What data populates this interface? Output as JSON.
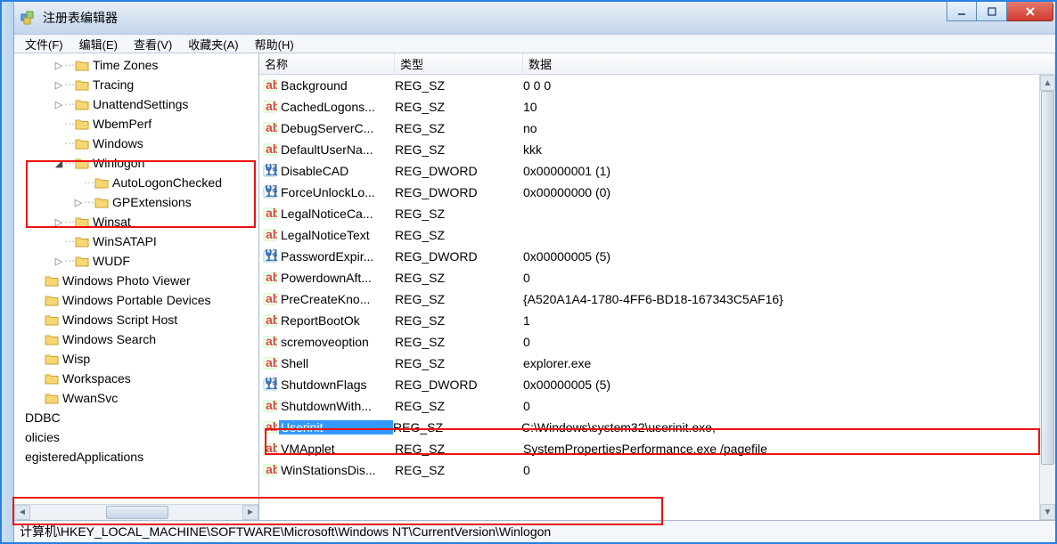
{
  "window": {
    "title": "注册表编辑器"
  },
  "menus": [
    "文件(F)",
    "编辑(E)",
    "查看(V)",
    "收藏夹(A)",
    "帮助(H)"
  ],
  "tree": [
    {
      "indent": 44,
      "toggle": "▷",
      "label": "Time Zones",
      "dots": true
    },
    {
      "indent": 44,
      "toggle": "▷",
      "label": "Tracing",
      "dots": true
    },
    {
      "indent": 44,
      "toggle": "▷",
      "label": "UnattendSettings",
      "dots": true
    },
    {
      "indent": 44,
      "toggle": "",
      "label": "WbemPerf",
      "dots": true
    },
    {
      "indent": 44,
      "toggle": "",
      "label": "Windows",
      "dots": true
    },
    {
      "indent": 44,
      "toggle": "▲",
      "label": "Winlogon",
      "dots": true,
      "expanded": true
    },
    {
      "indent": 66,
      "toggle": "",
      "label": "AutoLogonChecked",
      "dots": true
    },
    {
      "indent": 66,
      "toggle": "▷",
      "label": "GPExtensions",
      "dots": true
    },
    {
      "indent": 44,
      "toggle": "▷",
      "label": "Winsat",
      "dots": true
    },
    {
      "indent": 44,
      "toggle": "",
      "label": "WinSATAPI",
      "dots": true
    },
    {
      "indent": 44,
      "toggle": "▷",
      "label": "WUDF",
      "dots": true
    },
    {
      "indent": 22,
      "toggle": "",
      "label": "Windows Photo Viewer",
      "dots": false
    },
    {
      "indent": 22,
      "toggle": "",
      "label": "Windows Portable Devices",
      "dots": false
    },
    {
      "indent": 22,
      "toggle": "",
      "label": "Windows Script Host",
      "dots": false
    },
    {
      "indent": 22,
      "toggle": "",
      "label": "Windows Search",
      "dots": false
    },
    {
      "indent": 22,
      "toggle": "",
      "label": "Wisp",
      "dots": false
    },
    {
      "indent": 22,
      "toggle": "",
      "label": "Workspaces",
      "dots": false
    },
    {
      "indent": 22,
      "toggle": "",
      "label": "WwanSvc",
      "dots": false
    },
    {
      "indent": 0,
      "toggle": "",
      "label": "DDBC",
      "dots": false,
      "nofolder": true,
      "cut": true
    },
    {
      "indent": 0,
      "toggle": "",
      "label": "olicies",
      "dots": false,
      "nofolder": true,
      "cut": true
    },
    {
      "indent": 0,
      "toggle": "",
      "label": "egisteredApplications",
      "dots": false,
      "nofolder": true,
      "cut": true
    }
  ],
  "columns": {
    "name": "名称",
    "type": "类型",
    "data": "数据"
  },
  "rows": [
    {
      "icon": "sz",
      "name": "Background",
      "type": "REG_SZ",
      "data": "0 0 0"
    },
    {
      "icon": "sz",
      "name": "CachedLogons...",
      "type": "REG_SZ",
      "data": "10"
    },
    {
      "icon": "sz",
      "name": "DebugServerC...",
      "type": "REG_SZ",
      "data": "no"
    },
    {
      "icon": "sz",
      "name": "DefaultUserNa...",
      "type": "REG_SZ",
      "data": "kkk"
    },
    {
      "icon": "dw",
      "name": "DisableCAD",
      "type": "REG_DWORD",
      "data": "0x00000001 (1)"
    },
    {
      "icon": "dw",
      "name": "ForceUnlockLo...",
      "type": "REG_DWORD",
      "data": "0x00000000 (0)"
    },
    {
      "icon": "sz",
      "name": "LegalNoticeCa...",
      "type": "REG_SZ",
      "data": ""
    },
    {
      "icon": "sz",
      "name": "LegalNoticeText",
      "type": "REG_SZ",
      "data": ""
    },
    {
      "icon": "dw",
      "name": "PasswordExpir...",
      "type": "REG_DWORD",
      "data": "0x00000005 (5)"
    },
    {
      "icon": "sz",
      "name": "PowerdownAft...",
      "type": "REG_SZ",
      "data": "0"
    },
    {
      "icon": "sz",
      "name": "PreCreateKno...",
      "type": "REG_SZ",
      "data": "{A520A1A4-1780-4FF6-BD18-167343C5AF16}"
    },
    {
      "icon": "sz",
      "name": "ReportBootOk",
      "type": "REG_SZ",
      "data": "1"
    },
    {
      "icon": "sz",
      "name": "scremoveoption",
      "type": "REG_SZ",
      "data": "0"
    },
    {
      "icon": "sz",
      "name": "Shell",
      "type": "REG_SZ",
      "data": "explorer.exe"
    },
    {
      "icon": "dw",
      "name": "ShutdownFlags",
      "type": "REG_DWORD",
      "data": "0x00000005 (5)"
    },
    {
      "icon": "sz",
      "name": "ShutdownWith...",
      "type": "REG_SZ",
      "data": "0"
    },
    {
      "icon": "sz",
      "name": "Userinit",
      "type": "REG_SZ",
      "data": "C:\\Windows\\system32\\userinit.exe,",
      "selected": true
    },
    {
      "icon": "sz",
      "name": "VMApplet",
      "type": "REG_SZ",
      "data": "SystemPropertiesPerformance.exe /pagefile"
    },
    {
      "icon": "sz",
      "name": "WinStationsDis...",
      "type": "REG_SZ",
      "data": "0"
    }
  ],
  "status": "计算机\\HKEY_LOCAL_MACHINE\\SOFTWARE\\Microsoft\\Windows NT\\CurrentVersion\\Winlogon"
}
